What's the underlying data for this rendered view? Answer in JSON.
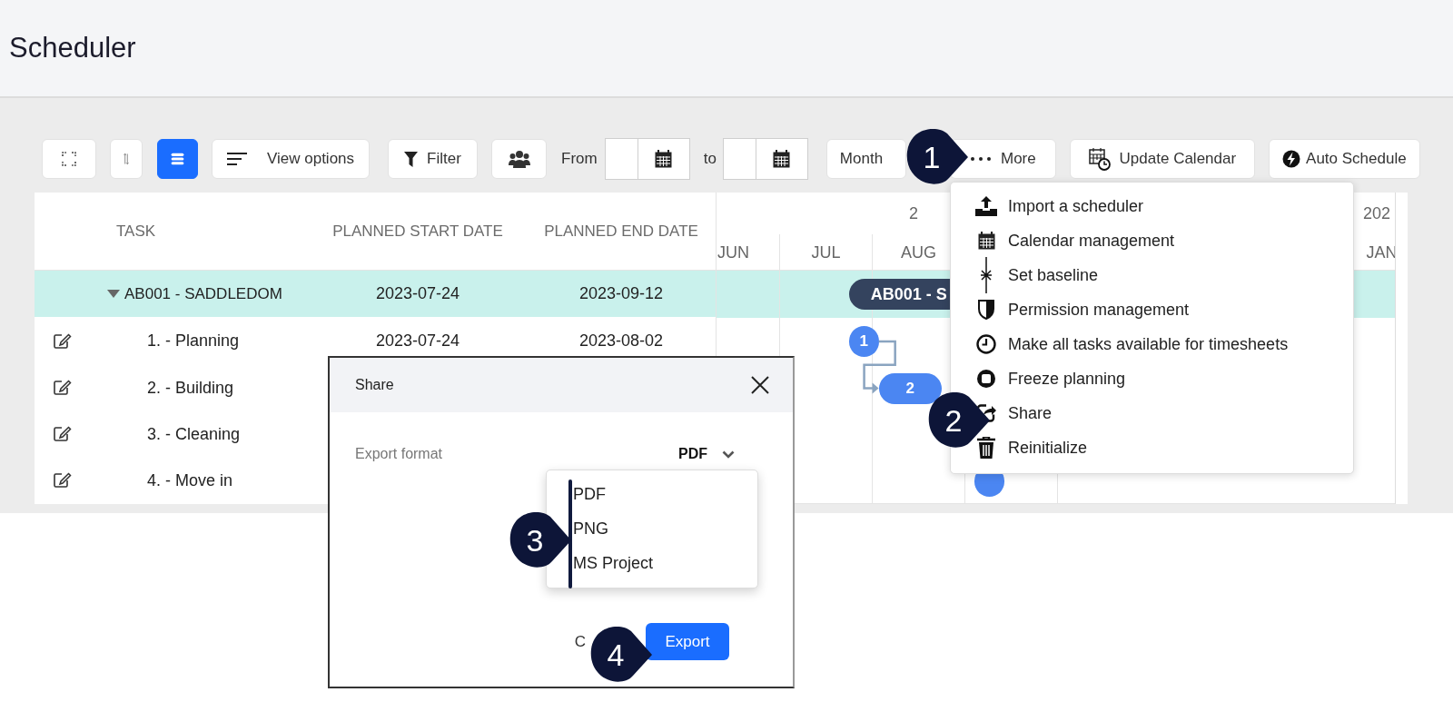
{
  "header": {
    "title": "Scheduler"
  },
  "toolbar": {
    "compact_view": {
      "selected": true
    },
    "view_options": "View options",
    "filter": "Filter",
    "from_label": "From",
    "to_label": "to",
    "scale": "Month",
    "more": "More",
    "update_calendar": "Update Calendar",
    "auto_schedule": "Auto Schedule"
  },
  "table": {
    "columns": [
      "TASK",
      "PLANNED START DATE",
      "PLANNED END DATE"
    ],
    "rows": [
      {
        "kind": "summary",
        "selected": true,
        "expanded": true,
        "task": "AB001 - SADDLEDOM",
        "start": "2023-07-24",
        "end": "2023-09-12"
      },
      {
        "kind": "task",
        "selected": false,
        "task": "1. - Planning",
        "start": "2023-07-24",
        "end": "2023-08-02"
      },
      {
        "kind": "task",
        "selected": false,
        "task": "2. - Building"
      },
      {
        "kind": "task",
        "selected": false,
        "task": "3. - Cleaning"
      },
      {
        "kind": "task",
        "selected": false,
        "task": "4. - Move in"
      }
    ]
  },
  "gantt": {
    "years": [
      {
        "label": "2"
      },
      {
        "label": "202"
      }
    ],
    "months": [
      {
        "label": "JUN"
      },
      {
        "label": "JUL"
      },
      {
        "label": "AUG"
      },
      {
        "label": "JAN"
      }
    ],
    "bars": [
      {
        "kind": "summary",
        "label": "AB001 - S"
      },
      {
        "kind": "task",
        "label": "1"
      },
      {
        "kind": "task",
        "label": "2"
      },
      {
        "kind": "task"
      }
    ]
  },
  "more_menu": {
    "items": [
      "Import a scheduler",
      "Calendar management",
      "Set baseline",
      "Permission management",
      "Make all tasks available for timesheets",
      "Freeze planning",
      "Share",
      "Reinitialize"
    ]
  },
  "share_dialog": {
    "title": "Share",
    "field_label": "Export format",
    "value": "PDF",
    "expanded": true,
    "options": [
      "PDF",
      "PNG",
      "MS Project"
    ],
    "cancel": "C",
    "submit": "Export"
  },
  "callouts": [
    "1",
    "2",
    "3",
    "4"
  ]
}
